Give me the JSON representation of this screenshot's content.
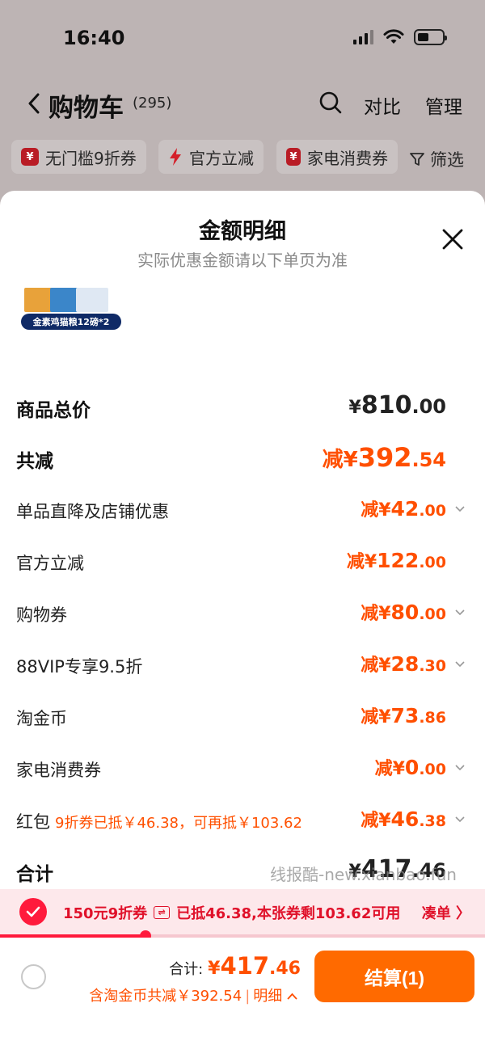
{
  "status_bar": {
    "time": "16:40"
  },
  "nav": {
    "title": "购物车",
    "count": "(295)",
    "compare": "对比",
    "manage": "管理"
  },
  "filters": {
    "chips": [
      "无门槛9折券",
      "官方立减",
      "家电消费券"
    ],
    "filter_label": "筛选"
  },
  "sheet": {
    "title": "金额明细",
    "subtitle": "实际优惠金额请以下单页为准",
    "product_label": "金素鸡猫粮12磅*2",
    "rows": [
      {
        "label": "商品总价",
        "yen": "¥",
        "int": "810",
        "dec": ".00"
      },
      {
        "label": "共减",
        "prefix": "减¥",
        "int": "392",
        "dec": ".54"
      },
      {
        "label": "单品直降及店铺优惠",
        "prefix": "减¥",
        "int": "42",
        "dec": ".00"
      },
      {
        "label": "官方立减",
        "prefix": "减¥",
        "int": "122",
        "dec": ".00"
      },
      {
        "label": "购物券",
        "prefix": "减¥",
        "int": "80",
        "dec": ".00"
      },
      {
        "label": "88VIP专享9.5折",
        "prefix": "减¥",
        "int": "28",
        "dec": ".30"
      },
      {
        "label": "淘金币",
        "prefix": "减¥",
        "int": "73",
        "dec": ".86"
      },
      {
        "label": "家电消费券",
        "prefix": "减¥",
        "int": "0",
        "dec": ".00"
      },
      {
        "label": "红包",
        "note": "9折券已抵￥46.38，可再抵￥103.62",
        "prefix": "减¥",
        "int": "46",
        "dec": ".38"
      },
      {
        "label": "合计",
        "yen": "¥",
        "int": "417",
        "dec": ".46"
      }
    ],
    "watermark": "线报酷-new.xianbao.fun"
  },
  "coupon_banner": {
    "coupon": "150元9折券",
    "swap_glyph": "⇌",
    "status": "已抵46.38,本张券剩103.62可用",
    "link": "凑单 〉",
    "progress": 0.3
  },
  "bottom_bar": {
    "total_label": "合计:",
    "total_yen": "¥",
    "total_int": "417",
    "total_dec": ".46",
    "saving_text": "含淘金币共减￥392.54",
    "detail_label": "明细",
    "checkout_label": "结算(1)"
  },
  "colors": {
    "accent": "#ff4f00",
    "checkout": "#ff6a00",
    "coupon_red": "#ff1a3c"
  }
}
